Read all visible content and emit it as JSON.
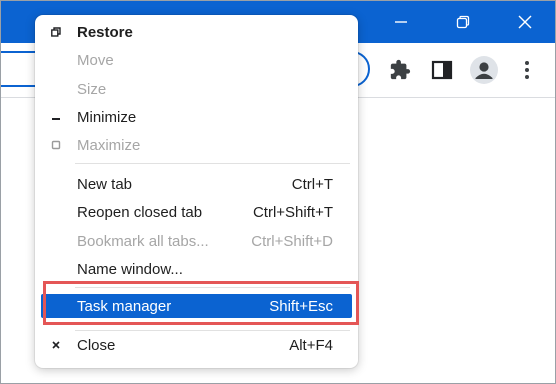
{
  "window_controls": {
    "minimize_glyph": "—",
    "restore_glyph": "❐",
    "close_glyph": "✕"
  },
  "toolbar": {
    "extensions_icon": "puzzle-icon",
    "side_panel_icon": "side-panel-icon",
    "profile_icon": "avatar-icon",
    "menu_icon": "three-dot-menu-icon"
  },
  "menu": {
    "items": [
      {
        "label": "Restore",
        "shortcut": "",
        "enabled": true,
        "bold": true,
        "icon": "restore-icon"
      },
      {
        "label": "Move",
        "shortcut": "",
        "enabled": false,
        "icon": ""
      },
      {
        "label": "Size",
        "shortcut": "",
        "enabled": false,
        "icon": ""
      },
      {
        "label": "Minimize",
        "shortcut": "",
        "enabled": true,
        "icon": "minimize-icon"
      },
      {
        "label": "Maximize",
        "shortcut": "",
        "enabled": false,
        "icon": "maximize-icon"
      },
      {
        "label": "New tab",
        "shortcut": "Ctrl+T",
        "enabled": true
      },
      {
        "label": "Reopen closed tab",
        "shortcut": "Ctrl+Shift+T",
        "enabled": true
      },
      {
        "label": "Bookmark all tabs...",
        "shortcut": "Ctrl+Shift+D",
        "enabled": false
      },
      {
        "label": "Name window...",
        "shortcut": "",
        "enabled": true
      },
      {
        "label": "Task manager",
        "shortcut": "Shift+Esc",
        "enabled": true,
        "selected": true
      },
      {
        "label": "Close",
        "shortcut": "Alt+F4",
        "enabled": true,
        "icon": "close-icon"
      }
    ]
  },
  "colors": {
    "accent": "#0b63d1",
    "highlight_border": "#e45656",
    "disabled_text": "#a6a6a6"
  }
}
